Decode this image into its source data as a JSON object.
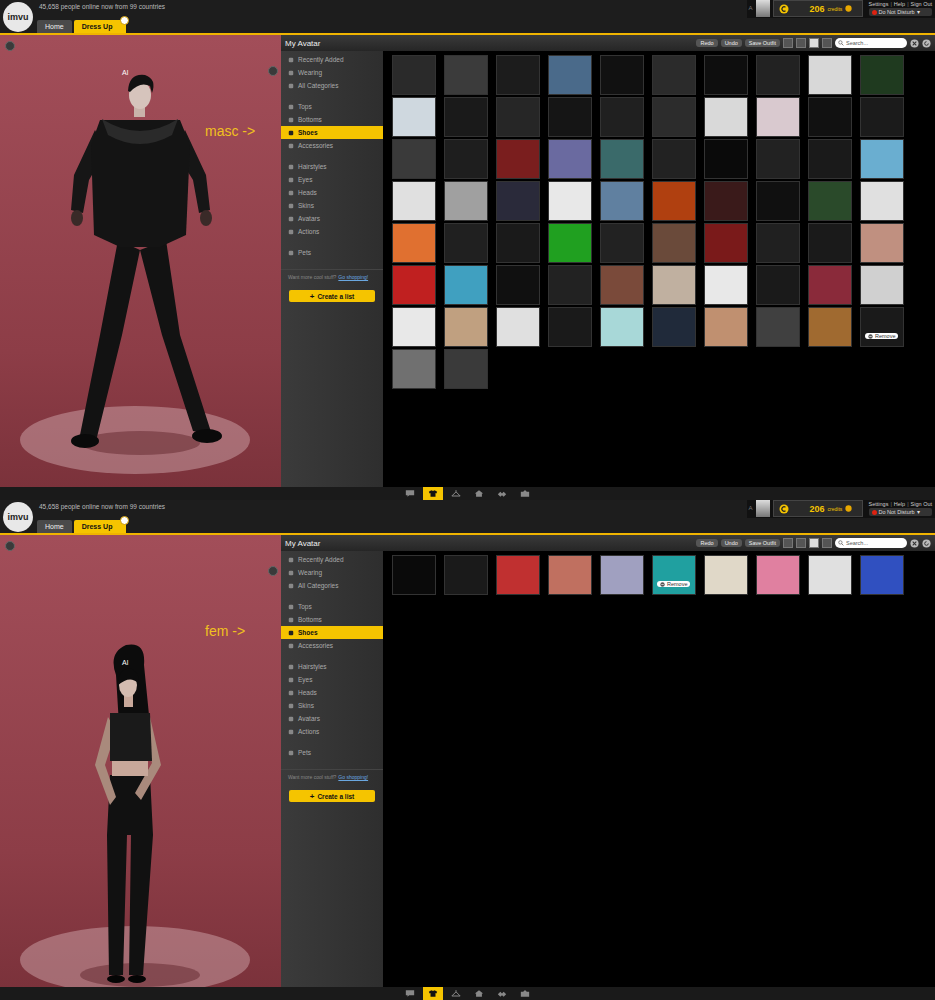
{
  "screens": [
    {
      "top_bar": {
        "logo": "imvu",
        "online": "45,658 people online now from 99 countries",
        "username": "A",
        "credits": "206",
        "credits_label": "credits",
        "links": [
          "Settings",
          "Help",
          "Sign Out"
        ],
        "link_separator": "|",
        "status": "Do Not Disturb",
        "status_caret": "▾"
      },
      "tabs": [
        {
          "label": "Home",
          "selected": false
        },
        {
          "label": "Dress Up",
          "selected": true
        }
      ],
      "avatar": {
        "name": "Al",
        "kind": "masc"
      },
      "annotation": "masc ->",
      "panel": {
        "title": "My Avatar",
        "buttons": [
          "Redo",
          "Undo",
          "Save Outfit"
        ],
        "search_placeholder": "Search..."
      },
      "sidebar": {
        "groups": [
          [
            {
              "label": "Recently Added",
              "selected": false
            },
            {
              "label": "Wearing",
              "selected": false
            },
            {
              "label": "All Categories",
              "selected": false
            }
          ],
          [
            {
              "label": "Tops",
              "selected": false
            },
            {
              "label": "Bottoms",
              "selected": false
            },
            {
              "label": "Shoes",
              "selected": true
            },
            {
              "label": "Accessories",
              "selected": false
            }
          ],
          [
            {
              "label": "Hairstyles",
              "selected": false
            },
            {
              "label": "Eyes",
              "selected": false
            },
            {
              "label": "Heads",
              "selected": false
            },
            {
              "label": "Skins",
              "selected": false
            },
            {
              "label": "Avatars",
              "selected": false
            },
            {
              "label": "Actions",
              "selected": false
            }
          ],
          [
            {
              "label": "Pets",
              "selected": false
            }
          ]
        ],
        "promo": "Want more cool stuff?",
        "promo_link": "Go shopping!",
        "create_icon": "+",
        "create_label": "Create a list"
      },
      "remove_label": "Remove",
      "items": [
        {
          "color": "#2a2a2a",
          "hovered": false
        },
        {
          "color": "#3b3b3b",
          "hovered": false
        },
        {
          "color": "#1c1c1c",
          "hovered": false
        },
        {
          "color": "#4a6a8a",
          "hovered": false
        },
        {
          "color": "#111111",
          "hovered": false
        },
        {
          "color": "#2b2b2b",
          "hovered": false
        },
        {
          "color": "#0e0e0e",
          "hovered": false
        },
        {
          "color": "#222222",
          "hovered": false
        },
        {
          "color": "#d8d8d8",
          "hovered": false
        },
        {
          "color": "#1f3a1f",
          "hovered": false
        },
        {
          "color": "#cfd8df",
          "hovered": false
        },
        {
          "color": "#1a1a1a",
          "hovered": false
        },
        {
          "color": "#262626",
          "hovered": false
        },
        {
          "color": "#151515",
          "hovered": false
        },
        {
          "color": "#202020",
          "hovered": false
        },
        {
          "color": "#2c2c2c",
          "hovered": false
        },
        {
          "color": "#d9d9d9",
          "hovered": false
        },
        {
          "color": "#d9c9cf",
          "hovered": false
        },
        {
          "color": "#111111",
          "hovered": false
        },
        {
          "color": "#1b1b1b",
          "hovered": false
        },
        {
          "color": "#3a3a3a",
          "hovered": false
        },
        {
          "color": "#1e1e1e",
          "hovered": false
        },
        {
          "color": "#7a1e1e",
          "hovered": false
        },
        {
          "color": "#6a6aa0",
          "hovered": false
        },
        {
          "color": "#3a6a6a",
          "hovered": false
        },
        {
          "color": "#222222",
          "hovered": false
        },
        {
          "color": "#0a0a0a",
          "hovered": false
        },
        {
          "color": "#222222",
          "hovered": false
        },
        {
          "color": "#1a1a1a",
          "hovered": false
        },
        {
          "color": "#6aaed0",
          "hovered": false
        },
        {
          "color": "#e0e0e0",
          "hovered": false
        },
        {
          "color": "#a0a0a0",
          "hovered": false
        },
        {
          "color": "#2a2a3a",
          "hovered": false
        },
        {
          "color": "#e8e8e8",
          "hovered": false
        },
        {
          "color": "#6080a0",
          "hovered": false
        },
        {
          "color": "#b04010",
          "hovered": false
        },
        {
          "color": "#3a1a1a",
          "hovered": false
        },
        {
          "color": "#101010",
          "hovered": false
        },
        {
          "color": "#2a4a2a",
          "hovered": false
        },
        {
          "color": "#e0e0e0",
          "hovered": false
        },
        {
          "color": "#e07030",
          "hovered": false
        },
        {
          "color": "#202020",
          "hovered": false
        },
        {
          "color": "#1a1a1a",
          "hovered": false
        },
        {
          "color": "#20a020",
          "hovered": false
        },
        {
          "color": "#222222",
          "hovered": false
        },
        {
          "color": "#6a4a3a",
          "hovered": false
        },
        {
          "color": "#7a1a1a",
          "hovered": false
        },
        {
          "color": "#202020",
          "hovered": false
        },
        {
          "color": "#1a1a1a",
          "hovered": false
        },
        {
          "color": "#c09080",
          "hovered": false
        },
        {
          "color": "#c02020",
          "hovered": false
        },
        {
          "color": "#40a0c0",
          "hovered": false
        },
        {
          "color": "#101010",
          "hovered": false
        },
        {
          "color": "#222222",
          "hovered": false
        },
        {
          "color": "#7a4a3a",
          "hovered": false
        },
        {
          "color": "#c0b0a0",
          "hovered": false
        },
        {
          "color": "#e8e8e8",
          "hovered": false
        },
        {
          "color": "#1a1a1a",
          "hovered": false
        },
        {
          "color": "#8a2a3a",
          "hovered": false
        },
        {
          "color": "#d0d0d0",
          "hovered": false
        },
        {
          "color": "#e8e8e8",
          "hovered": false
        },
        {
          "color": "#c0a080",
          "hovered": false
        },
        {
          "color": "#e0e0e0",
          "hovered": false
        },
        {
          "color": "#1a1a1a",
          "hovered": false
        },
        {
          "color": "#a8d8d8",
          "hovered": false
        },
        {
          "color": "#202a3a",
          "hovered": false
        },
        {
          "color": "#c09070",
          "hovered": false
        },
        {
          "color": "#404040",
          "hovered": false
        },
        {
          "color": "#a06a30",
          "hovered": false
        },
        {
          "color": "#1a1a1a",
          "hovered": true
        },
        {
          "color": "#707070",
          "hovered": false
        },
        {
          "color": "#3a3a3a",
          "hovered": false
        }
      ],
      "toolbar": [
        {
          "kind": "chat",
          "selected": false
        },
        {
          "kind": "outfit",
          "selected": true
        },
        {
          "kind": "hanger",
          "selected": false
        },
        {
          "kind": "home",
          "selected": false
        },
        {
          "kind": "hands",
          "selected": false
        },
        {
          "kind": "camera",
          "selected": false
        }
      ]
    },
    {
      "top_bar": {
        "logo": "imvu",
        "online": "45,658 people online now from 99 countries",
        "username": "A",
        "credits": "206",
        "credits_label": "credits",
        "links": [
          "Settings",
          "Help",
          "Sign Out"
        ],
        "link_separator": "|",
        "status": "Do Not Disturb",
        "status_caret": "▾"
      },
      "tabs": [
        {
          "label": "Home",
          "selected": false
        },
        {
          "label": "Dress Up",
          "selected": true
        }
      ],
      "avatar": {
        "name": "Al",
        "kind": "fem"
      },
      "annotation": "fem ->",
      "panel": {
        "title": "My Avatar",
        "buttons": [
          "Redo",
          "Undo",
          "Save Outfit"
        ],
        "search_placeholder": "Search..."
      },
      "sidebar": {
        "groups": [
          [
            {
              "label": "Recently Added",
              "selected": false
            },
            {
              "label": "Wearing",
              "selected": false
            },
            {
              "label": "All Categories",
              "selected": false
            }
          ],
          [
            {
              "label": "Tops",
              "selected": false
            },
            {
              "label": "Bottoms",
              "selected": false
            },
            {
              "label": "Shoes",
              "selected": true
            },
            {
              "label": "Accessories",
              "selected": false
            }
          ],
          [
            {
              "label": "Hairstyles",
              "selected": false
            },
            {
              "label": "Eyes",
              "selected": false
            },
            {
              "label": "Heads",
              "selected": false
            },
            {
              "label": "Skins",
              "selected": false
            },
            {
              "label": "Avatars",
              "selected": false
            },
            {
              "label": "Actions",
              "selected": false
            }
          ],
          [
            {
              "label": "Pets",
              "selected": false
            }
          ]
        ],
        "promo": "Want more cool stuff?",
        "promo_link": "Go shopping!",
        "create_icon": "+",
        "create_label": "Create a list"
      },
      "remove_label": "Remove",
      "items": [
        {
          "color": "#0a0a0a",
          "hovered": false
        },
        {
          "color": "#1a1a1a",
          "hovered": false
        },
        {
          "color": "#c03030",
          "hovered": false
        },
        {
          "color": "#c07060",
          "hovered": false
        },
        {
          "color": "#a0a0c0",
          "hovered": false
        },
        {
          "color": "#20a0a0",
          "hovered": true
        },
        {
          "color": "#e0d8c8",
          "hovered": false
        },
        {
          "color": "#e080a0",
          "hovered": false
        },
        {
          "color": "#e0e0e0",
          "hovered": false
        },
        {
          "color": "#3050c0",
          "hovered": false
        }
      ],
      "toolbar": [
        {
          "kind": "chat",
          "selected": false
        },
        {
          "kind": "outfit",
          "selected": true
        },
        {
          "kind": "hanger",
          "selected": false
        },
        {
          "kind": "home",
          "selected": false
        },
        {
          "kind": "hands",
          "selected": false
        },
        {
          "kind": "camera",
          "selected": false
        }
      ]
    }
  ]
}
